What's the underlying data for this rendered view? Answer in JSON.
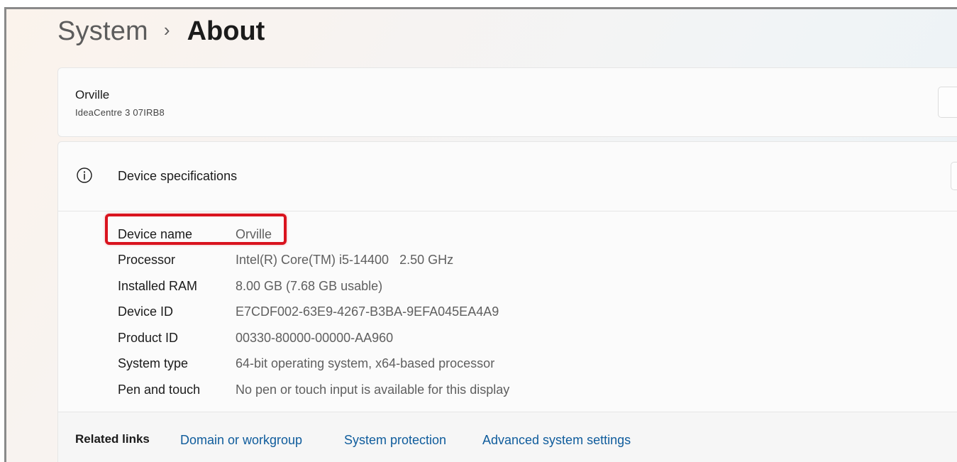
{
  "breadcrumb": {
    "parent": "System",
    "separator": "›",
    "current": "About"
  },
  "device": {
    "name": "Orville",
    "model": "IdeaCentre 3 07IRB8"
  },
  "specs": {
    "icon": "info-icon",
    "title": "Device specifications",
    "rows": [
      {
        "label": "Device name",
        "value": "Orville"
      },
      {
        "label": "Processor",
        "value": "Intel(R) Core(TM) i5-14400   2.50 GHz"
      },
      {
        "label": "Installed RAM",
        "value": "8.00 GB (7.68 GB usable)"
      },
      {
        "label": "Device ID",
        "value": "E7CDF002-63E9-4267-B3BA-9EFA045EA4A9"
      },
      {
        "label": "Product ID",
        "value": "00330-80000-00000-AA960"
      },
      {
        "label": "System type",
        "value": "64-bit operating system, x64-based processor"
      },
      {
        "label": "Pen and touch",
        "value": "No pen or touch input is available for this display"
      }
    ]
  },
  "related": {
    "title": "Related links",
    "links": [
      "Domain or workgroup",
      "System protection",
      "Advanced system settings"
    ]
  },
  "colors": {
    "accent_link": "#0f5c9c",
    "highlight": "#d9131e"
  }
}
